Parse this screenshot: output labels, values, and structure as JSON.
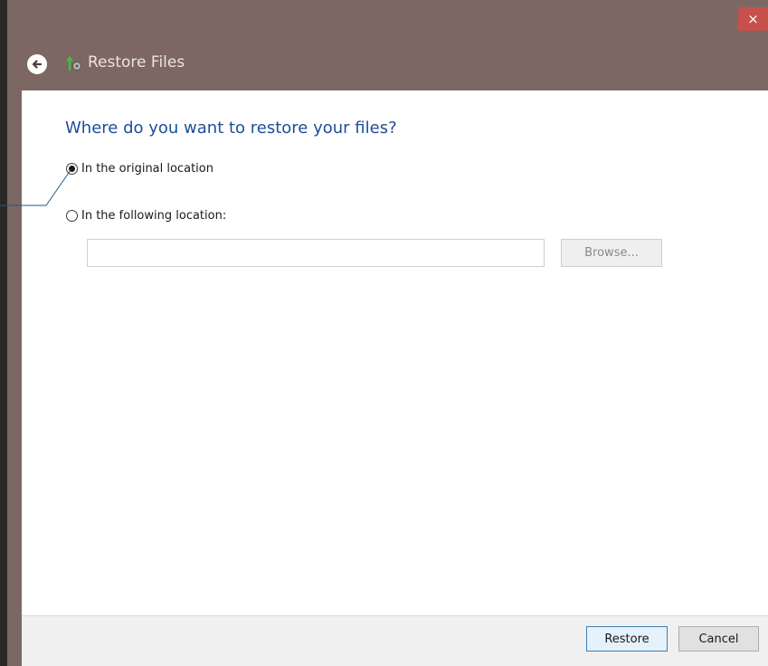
{
  "window": {
    "title": "Restore Files",
    "close_label": "×"
  },
  "main": {
    "heading": "Where do you want to restore your files?",
    "options": [
      {
        "label": "In the original location",
        "selected": true
      },
      {
        "label": "In the following location:",
        "selected": false
      }
    ],
    "location_input": {
      "value": "",
      "placeholder": ""
    },
    "browse_label": "Browse..."
  },
  "footer": {
    "restore_label": "Restore",
    "cancel_label": "Cancel"
  },
  "colors": {
    "titlebar": "#7d6763",
    "heading": "#1e4d9a",
    "close": "#c7504c"
  },
  "icons": {
    "back": "back-arrow-icon",
    "app": "restore-files-icon",
    "close": "close-icon"
  }
}
